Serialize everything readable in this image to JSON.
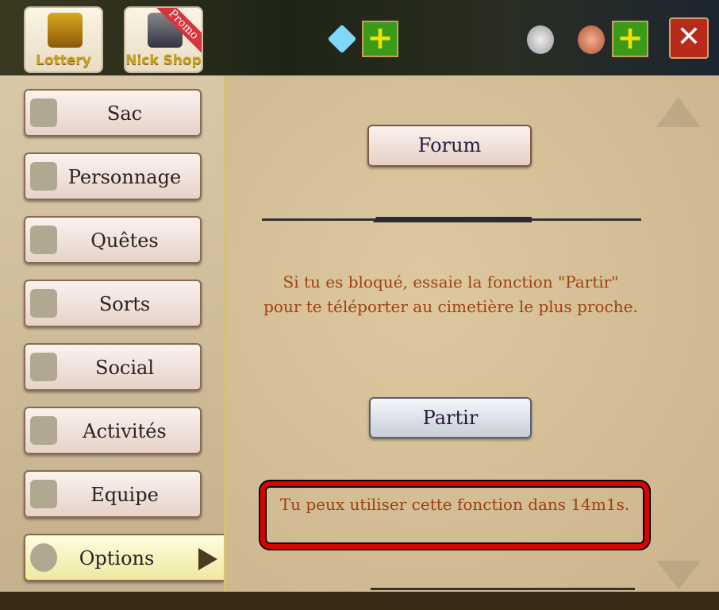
{
  "topbar": {
    "lottery_label": "Lottery",
    "nickshop_label": "Nick Shop",
    "promo_badge": "Promo",
    "icons": [
      "treasure-chest-icon",
      "diamond-icon",
      "plus-icon",
      "silver-coin-icon",
      "copper-coin-icon",
      "plus-icon",
      "close-icon"
    ],
    "close_glyph": "✕",
    "plus_glyph": "+"
  },
  "sidebar": {
    "items": [
      {
        "label": "Sac",
        "icon": "bag-icon"
      },
      {
        "label": "Personnage",
        "icon": "helmet-icon"
      },
      {
        "label": "Quêtes",
        "icon": "scroll-icon"
      },
      {
        "label": "Sorts",
        "icon": "spellbook-icon"
      },
      {
        "label": "Social",
        "icon": "handshake-icon"
      },
      {
        "label": "Activités",
        "icon": "calendar-icon"
      },
      {
        "label": "Equipe",
        "icon": "team-emblem-icon"
      },
      {
        "label": "Options",
        "icon": "gear-icon",
        "selected": true
      }
    ]
  },
  "main": {
    "forum_label": "Forum",
    "info_text": "Si tu es bloqué, essaie la fonction \"Partir\" pour te téléporter au cimetière le plus proche.",
    "partir_label": "Partir",
    "cooldown_text": "Tu peux utiliser cette fonction dans 14m1s."
  },
  "colors": {
    "info_text": "#a04010",
    "highlight_box": "#dd0000",
    "selected_item": "#fffde0"
  }
}
